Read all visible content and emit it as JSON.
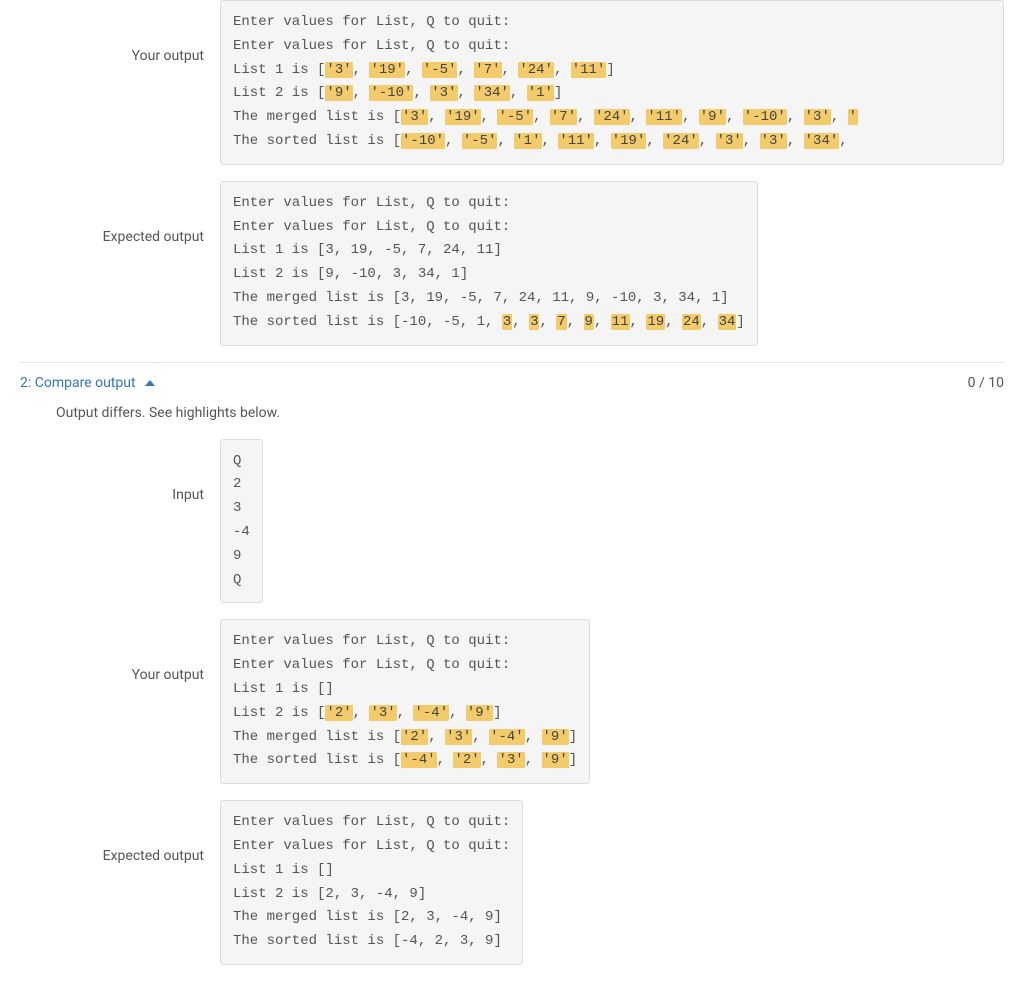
{
  "test1": {
    "your_output_label": "Your output",
    "expected_output_label": "Expected output",
    "your_output_lines": [
      [
        {
          "t": "Enter values for List, Q to quit:"
        }
      ],
      [
        {
          "t": "Enter values for List, Q to quit:"
        }
      ],
      [
        {
          "t": "List 1 is ["
        },
        {
          "t": "'3'",
          "h": true
        },
        {
          "t": ", "
        },
        {
          "t": "'19'",
          "h": true
        },
        {
          "t": ", "
        },
        {
          "t": "'-5'",
          "h": true
        },
        {
          "t": ", "
        },
        {
          "t": "'7'",
          "h": true
        },
        {
          "t": ", "
        },
        {
          "t": "'24'",
          "h": true
        },
        {
          "t": ", "
        },
        {
          "t": "'11'",
          "h": true
        },
        {
          "t": "]"
        }
      ],
      [
        {
          "t": "List 2 is ["
        },
        {
          "t": "'9'",
          "h": true
        },
        {
          "t": ", "
        },
        {
          "t": "'-10'",
          "h": true
        },
        {
          "t": ", "
        },
        {
          "t": "'3'",
          "h": true
        },
        {
          "t": ", "
        },
        {
          "t": "'34'",
          "h": true
        },
        {
          "t": ", "
        },
        {
          "t": "'1'",
          "h": true
        },
        {
          "t": "]"
        }
      ],
      [
        {
          "t": "The merged list is ["
        },
        {
          "t": "'3'",
          "h": true
        },
        {
          "t": ", "
        },
        {
          "t": "'19'",
          "h": true
        },
        {
          "t": ", "
        },
        {
          "t": "'-5'",
          "h": true
        },
        {
          "t": ", "
        },
        {
          "t": "'7'",
          "h": true
        },
        {
          "t": ", "
        },
        {
          "t": "'24'",
          "h": true
        },
        {
          "t": ", "
        },
        {
          "t": "'11'",
          "h": true
        },
        {
          "t": ", "
        },
        {
          "t": "'9'",
          "h": true
        },
        {
          "t": ", "
        },
        {
          "t": "'-10'",
          "h": true
        },
        {
          "t": ", "
        },
        {
          "t": "'3'",
          "h": true
        },
        {
          "t": ", "
        },
        {
          "t": "'",
          "h": true
        }
      ],
      [
        {
          "t": "The sorted list is ["
        },
        {
          "t": "'-10'",
          "h": true
        },
        {
          "t": ", "
        },
        {
          "t": "'-5'",
          "h": true
        },
        {
          "t": ", "
        },
        {
          "t": "'1'",
          "h": true
        },
        {
          "t": ", "
        },
        {
          "t": "'11'",
          "h": true
        },
        {
          "t": ", "
        },
        {
          "t": "'19'",
          "h": true
        },
        {
          "t": ", "
        },
        {
          "t": "'24'",
          "h": true
        },
        {
          "t": ", "
        },
        {
          "t": "'3'",
          "h": true
        },
        {
          "t": ", "
        },
        {
          "t": "'3'",
          "h": true
        },
        {
          "t": ", "
        },
        {
          "t": "'34'",
          "h": true
        },
        {
          "t": ","
        }
      ]
    ],
    "expected_output_lines": [
      [
        {
          "t": "Enter values for List, Q to quit:"
        }
      ],
      [
        {
          "t": "Enter values for List, Q to quit:"
        }
      ],
      [
        {
          "t": "List 1 is [3, 19, -5, 7, 24, 11]"
        }
      ],
      [
        {
          "t": "List 2 is [9, -10, 3, 34, 1]"
        }
      ],
      [
        {
          "t": "The merged list is [3, 19, -5, 7, 24, 11, 9, -10, 3, 34, 1]"
        }
      ],
      [
        {
          "t": "The sorted list is [-10, -5, 1, "
        },
        {
          "t": "3",
          "h": true
        },
        {
          "t": ", "
        },
        {
          "t": "3",
          "h": true
        },
        {
          "t": ", "
        },
        {
          "t": "7",
          "h": true
        },
        {
          "t": ", "
        },
        {
          "t": "9",
          "h": true
        },
        {
          "t": ", "
        },
        {
          "t": "11",
          "h": true
        },
        {
          "t": ", "
        },
        {
          "t": "19",
          "h": true
        },
        {
          "t": ", "
        },
        {
          "t": "24",
          "h": true
        },
        {
          "t": ", "
        },
        {
          "t": "34",
          "h": true
        },
        {
          "t": "]"
        }
      ]
    ]
  },
  "section2": {
    "title": "2: Compare output",
    "score": "0 / 10",
    "msg": "Output differs. See highlights below."
  },
  "test2": {
    "input_label": "Input",
    "your_output_label": "Your output",
    "expected_output_label": "Expected output",
    "input_lines": [
      [
        {
          "t": "Q"
        }
      ],
      [
        {
          "t": "2"
        }
      ],
      [
        {
          "t": "3"
        }
      ],
      [
        {
          "t": "-4"
        }
      ],
      [
        {
          "t": "9"
        }
      ],
      [
        {
          "t": "Q"
        }
      ]
    ],
    "your_output_lines": [
      [
        {
          "t": "Enter values for List, Q to quit:"
        }
      ],
      [
        {
          "t": "Enter values for List, Q to quit:"
        }
      ],
      [
        {
          "t": "List 1 is []"
        }
      ],
      [
        {
          "t": "List 2 is ["
        },
        {
          "t": "'2'",
          "h": true
        },
        {
          "t": ", "
        },
        {
          "t": "'3'",
          "h": true
        },
        {
          "t": ", "
        },
        {
          "t": "'-4'",
          "h": true
        },
        {
          "t": ", "
        },
        {
          "t": "'9'",
          "h": true
        },
        {
          "t": "]"
        }
      ],
      [
        {
          "t": "The merged list is ["
        },
        {
          "t": "'2'",
          "h": true
        },
        {
          "t": ", "
        },
        {
          "t": "'3'",
          "h": true
        },
        {
          "t": ", "
        },
        {
          "t": "'-4'",
          "h": true
        },
        {
          "t": ", "
        },
        {
          "t": "'9'",
          "h": true
        },
        {
          "t": "]"
        }
      ],
      [
        {
          "t": "The sorted list is ["
        },
        {
          "t": "'-4'",
          "h": true
        },
        {
          "t": ", "
        },
        {
          "t": "'2'",
          "h": true
        },
        {
          "t": ", "
        },
        {
          "t": "'3'",
          "h": true
        },
        {
          "t": ", "
        },
        {
          "t": "'9'",
          "h": true
        },
        {
          "t": "]"
        }
      ]
    ],
    "expected_output_lines": [
      [
        {
          "t": "Enter values for List, Q to quit:"
        }
      ],
      [
        {
          "t": "Enter values for List, Q to quit:"
        }
      ],
      [
        {
          "t": "List 1 is []"
        }
      ],
      [
        {
          "t": "List 2 is [2, 3, -4, 9]"
        }
      ],
      [
        {
          "t": "The merged list is [2, 3, -4, 9]"
        }
      ],
      [
        {
          "t": "The sorted list is [-4, 2, 3, 9]"
        }
      ]
    ]
  }
}
